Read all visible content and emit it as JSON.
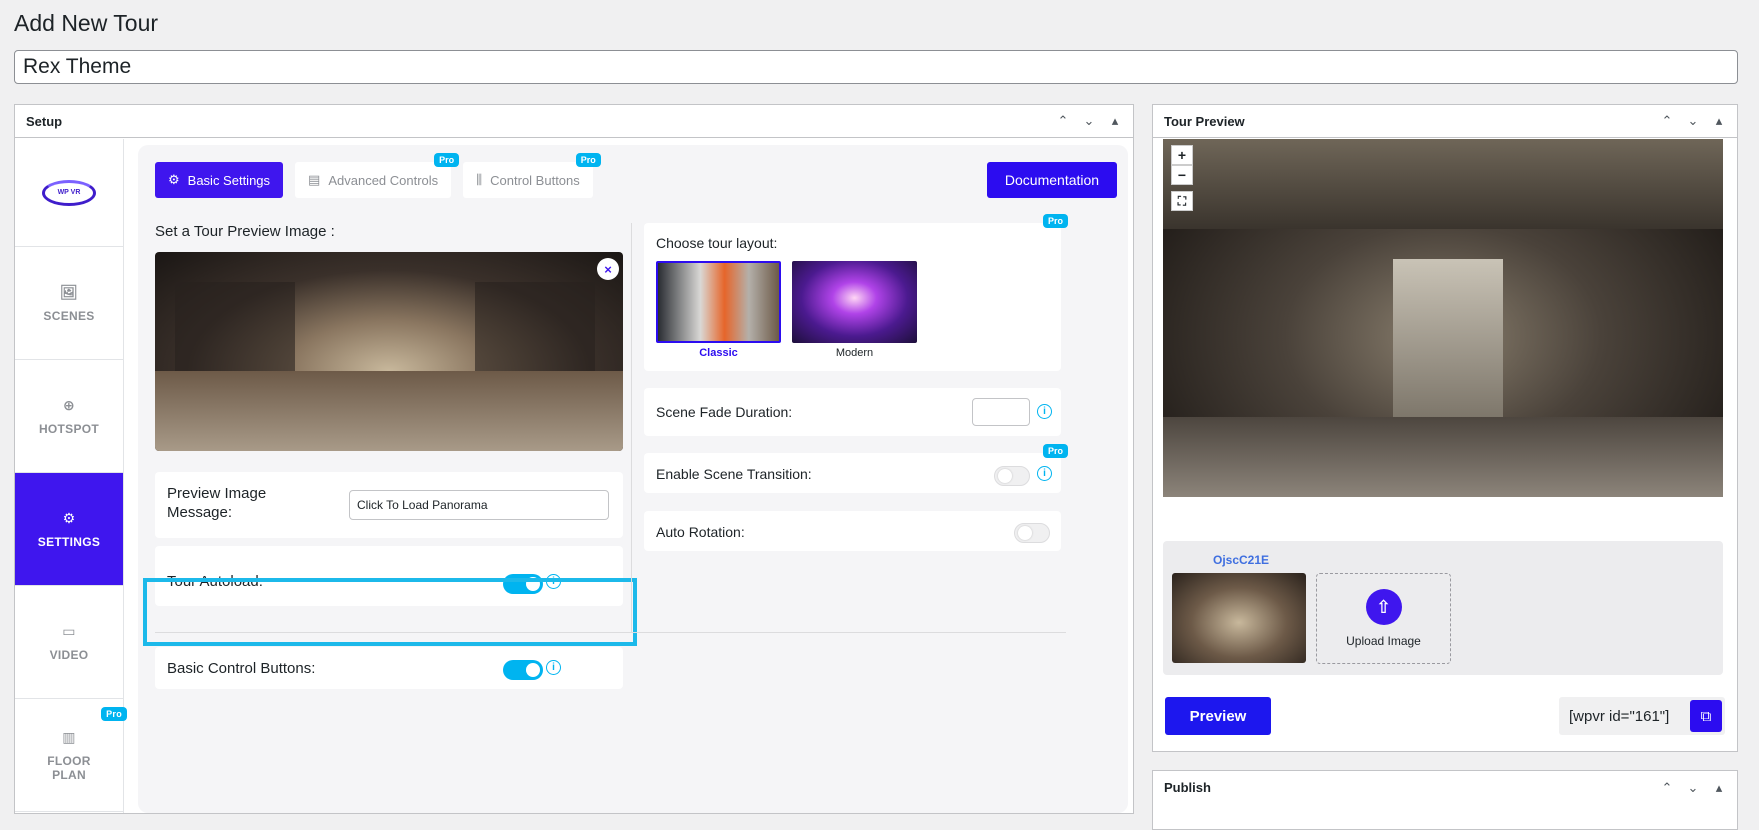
{
  "page": {
    "title": "Add New Tour",
    "tour_name": "Rex Theme"
  },
  "setup": {
    "heading": "Setup",
    "logo_text": "WP VR",
    "side_tabs": [
      {
        "label": "SCENES",
        "icon": "image-icon"
      },
      {
        "label": "HOTSPOT",
        "icon": "crosshair-icon"
      },
      {
        "label": "SETTINGS",
        "icon": "gear-icon",
        "active": true
      },
      {
        "label": "VIDEO",
        "icon": "video-icon"
      },
      {
        "label": "FLOOR\nPLAN",
        "icon": "map-icon",
        "pro": true
      }
    ],
    "pro_label": "Pro",
    "tabs": {
      "basic": "Basic Settings",
      "advanced": "Advanced Controls",
      "control": "Control Buttons"
    },
    "documentation": "Documentation",
    "preview_image_label": "Set a Tour Preview Image :",
    "close_glyph": "×",
    "preview_message_label": "Preview Image\nMessage:",
    "preview_message_value": "Click To Load Panorama",
    "tour_autoload_label": "Tour Autoload:",
    "tour_autoload": true,
    "basic_control_label": "Basic Control Buttons:",
    "basic_control": true,
    "choose_layout_label": "Choose tour layout:",
    "layouts": [
      {
        "name": "Classic",
        "selected": true
      },
      {
        "name": "Modern",
        "selected": false
      }
    ],
    "scene_fade_label": "Scene Fade Duration:",
    "scene_fade_value": "",
    "scene_transition_label": "Enable Scene Transition:",
    "scene_transition": false,
    "auto_rotation_label": "Auto Rotation:",
    "auto_rotation": false,
    "info_glyph": "i"
  },
  "preview": {
    "heading": "Tour Preview",
    "zoom_in": "+",
    "zoom_out": "−",
    "fullscreen": "⛶",
    "scene_id": "OjscC21E",
    "upload_label": "Upload Image",
    "preview_button": "Preview",
    "shortcode": "[wpvr id=\"161\"]"
  },
  "publish": {
    "heading": "Publish"
  },
  "box_controls": {
    "up": "⌃",
    "down": "⌄",
    "toggle": "▴"
  },
  "colors": {
    "accent": "#3f16ee",
    "toggle_on": "#00b4f0",
    "highlight": "#1cb9ea"
  }
}
